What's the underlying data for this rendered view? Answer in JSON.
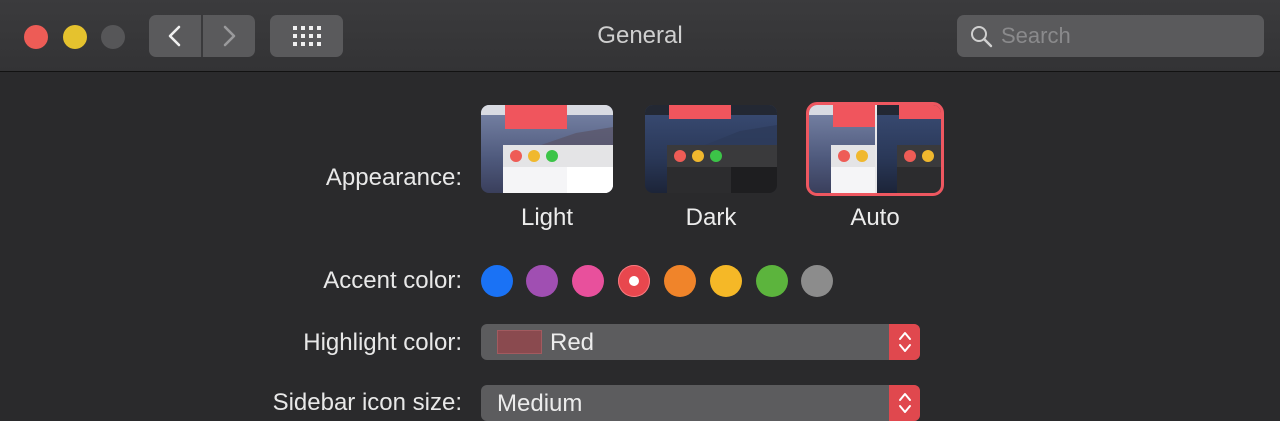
{
  "window": {
    "title": "General",
    "search_placeholder": "Search"
  },
  "appearance": {
    "label": "Appearance:",
    "options": [
      {
        "name": "Light"
      },
      {
        "name": "Dark"
      },
      {
        "name": "Auto",
        "selected": true
      }
    ]
  },
  "accent": {
    "label": "Accent color:",
    "colors": [
      "#1a72f5",
      "#a04fb2",
      "#e8509c",
      "#e8474e",
      "#f0842a",
      "#f5b827",
      "#5cb43d",
      "#8c8c8c"
    ],
    "selected_color": "#e8474e"
  },
  "highlight": {
    "label": "Highlight color:",
    "value": "Red",
    "swatch_color": "#8a4a4f"
  },
  "sidebar_icon_size": {
    "label": "Sidebar icon size:",
    "value": "Medium"
  },
  "colors": {
    "accent": "#e0484e",
    "background": "#2a2a2c"
  }
}
